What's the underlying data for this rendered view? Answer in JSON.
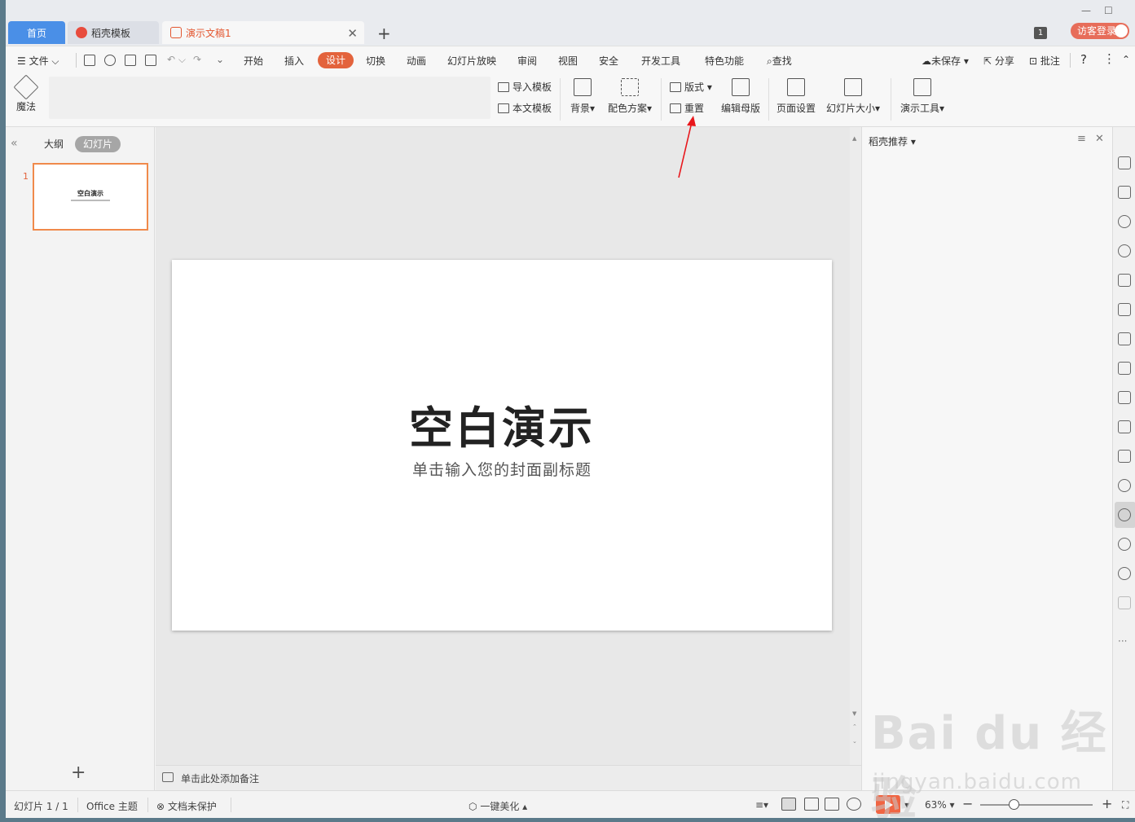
{
  "tabs": {
    "home": "首页",
    "docer": "稻壳模板",
    "document": "演示文稿1",
    "badge": "1",
    "login": "访客登录"
  },
  "menu": {
    "file": "文件",
    "items": [
      "开始",
      "插入",
      "设计",
      "切换",
      "动画",
      "幻灯片放映",
      "审阅",
      "视图",
      "安全",
      "开发工具",
      "特色功能"
    ],
    "active": "设计",
    "search": "查找",
    "unsaved": "未保存",
    "share": "分享",
    "comment": "批注",
    "help": "?"
  },
  "ribbon": {
    "magic": "魔法",
    "import_template": "导入模板",
    "this_template": "本文模板",
    "background": "背景",
    "color_scheme": "配色方案",
    "layout": "版式",
    "reset": "重置",
    "edit_master": "编辑母版",
    "page_setup": "页面设置",
    "slide_size": "幻灯片大小",
    "present_tools": "演示工具"
  },
  "left_panel": {
    "outline": "大纲",
    "slides": "幻灯片",
    "slide_number": "1",
    "thumb_title": "空白演示"
  },
  "slide": {
    "title": "空白演示",
    "subtitle": "单击输入您的封面副标题"
  },
  "notes": {
    "placeholder": "单击此处添加备注"
  },
  "right_pane": {
    "title": "稻壳推荐"
  },
  "status": {
    "slide_count": "幻灯片 1 / 1",
    "theme": "Office 主题",
    "protection": "文档未保护",
    "beautify": "一键美化",
    "zoom": "63%"
  },
  "watermark": {
    "brand": "Bai du 经验",
    "url": "jingyan.baidu.com"
  },
  "colors": {
    "accent": "#e3633c",
    "home_tab": "#4a8fe7",
    "play": "#f06543",
    "annotation": "#e8161b"
  }
}
